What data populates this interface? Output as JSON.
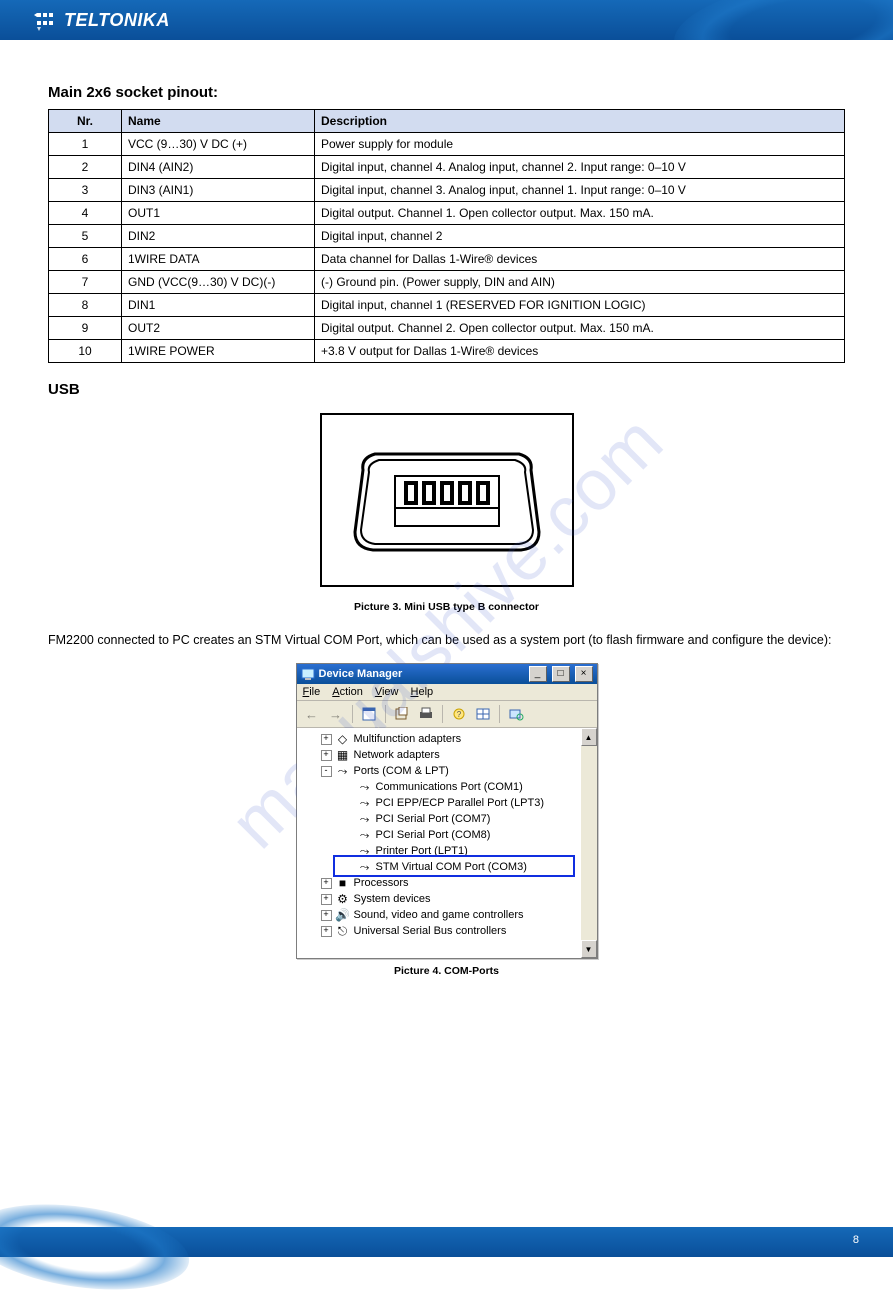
{
  "brand": {
    "name": "TELTONIKA"
  },
  "watermark": "manualshive.com",
  "table": {
    "title": "Main 2x6 socket pinout:",
    "headers": [
      "Nr.",
      "Name",
      "Description"
    ],
    "rows": [
      [
        "1",
        "VCC (9…30) V DC (+)",
        "Power supply for module"
      ],
      [
        "2",
        "DIN4 (AIN2)",
        "Digital input, channel 4. Analog input, channel 2. Input range: 0–10 V"
      ],
      [
        "3",
        "DIN3 (AIN1)",
        "Digital input, channel 3. Analog input, channel 1. Input range: 0–10 V"
      ],
      [
        "4",
        "OUT1",
        "Digital output. Channel 1. Open collector output. Max. 150 mA."
      ],
      [
        "5",
        "DIN2",
        "Digital input, channel 2"
      ],
      [
        "6",
        "1WIRE DATA",
        "Data channel for Dallas 1-Wire® devices"
      ],
      [
        "7",
        "GND (VCC(9…30) V DC)(-)",
        "(-) Ground pin. (Power supply, DIN and AIN)"
      ],
      [
        "8",
        "DIN1",
        "Digital input, channel 1 (RESERVED FOR IGNITION LOGIC)"
      ],
      [
        "9",
        "OUT2",
        "Digital output. Channel 2. Open collector output. Max. 150 mA."
      ],
      [
        "10",
        "1WIRE POWER",
        "+3.8 V output for Dallas 1-Wire® devices"
      ]
    ]
  },
  "usb_section": {
    "heading": "USB",
    "figure_caption_1": "Picture 3. Mini USB type B connector",
    "body": "FM2200 connected to PC creates an STM Virtual COM Port, which can be used as a system port (to flash firmware and configure the device):",
    "figure_caption_2": "Picture 4. COM-Ports"
  },
  "devmgr": {
    "title": "Device Manager",
    "menu": [
      "File",
      "Action",
      "View",
      "Help"
    ],
    "tree": [
      {
        "level": 1,
        "expand": "+",
        "icon": "diamond",
        "label": "Multifunction adapters"
      },
      {
        "level": 1,
        "expand": "+",
        "icon": "net",
        "label": "Network adapters"
      },
      {
        "level": 1,
        "expand": "-",
        "icon": "port",
        "label": "Ports (COM & LPT)"
      },
      {
        "level": 2,
        "expand": "",
        "icon": "port",
        "label": "Communications Port (COM1)"
      },
      {
        "level": 2,
        "expand": "",
        "icon": "port",
        "label": "PCI EPP/ECP Parallel Port (LPT3)"
      },
      {
        "level": 2,
        "expand": "",
        "icon": "port",
        "label": "PCI Serial Port (COM7)"
      },
      {
        "level": 2,
        "expand": "",
        "icon": "port",
        "label": "PCI Serial Port (COM8)"
      },
      {
        "level": 2,
        "expand": "",
        "icon": "port",
        "label": "Printer Port (LPT1)"
      },
      {
        "level": 2,
        "expand": "",
        "icon": "port",
        "label": "STM Virtual COM Port (COM3)"
      },
      {
        "level": 1,
        "expand": "+",
        "icon": "cpu",
        "label": "Processors"
      },
      {
        "level": 1,
        "expand": "+",
        "icon": "sys",
        "label": "System devices"
      },
      {
        "level": 1,
        "expand": "+",
        "icon": "snd",
        "label": "Sound, video and game controllers"
      },
      {
        "level": 1,
        "expand": "+",
        "icon": "usb",
        "label": "Universal Serial Bus controllers"
      }
    ]
  },
  "footer": {
    "page": "8",
    "total": ""
  }
}
